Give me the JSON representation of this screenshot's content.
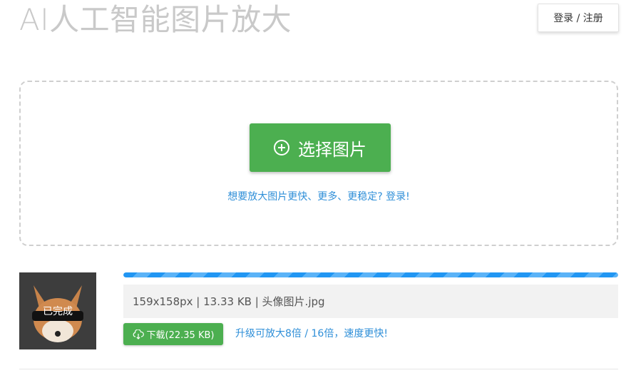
{
  "header": {
    "title": "AI人工智能图片放大",
    "login_label": "登录 / 注册"
  },
  "upload": {
    "select_button_label": "选择图片",
    "select_icon": "plus-circle-icon",
    "hint_text": "想要放大图片更快、更多、更稳定? 登录!"
  },
  "result": {
    "status": "已完成",
    "progress_percent": 100,
    "file_info": "159x158px | 13.33 KB | 头像图片.jpg",
    "download_label": "下载(22.35 KB)",
    "download_icon": "cloud-download-icon",
    "upgrade_text": "升级可放大8倍 / 16倍，速度更快!"
  },
  "colors": {
    "primary_green": "#4caf50",
    "link_blue": "#2f8fd8",
    "progress_blue": "#2196f3",
    "title_gray": "#c9c9c9"
  }
}
